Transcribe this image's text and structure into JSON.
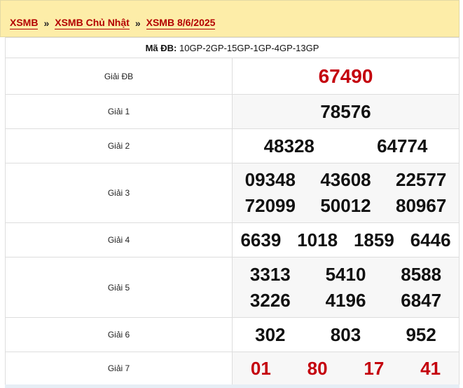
{
  "breadcrumb": {
    "items": [
      "XSMB",
      "XSMB Chủ Nhật",
      "XSMB 8/6/2025"
    ],
    "separator": "»"
  },
  "ma_db": {
    "label": "Mã ĐB:",
    "value": "10GP-2GP-15GP-1GP-4GP-13GP"
  },
  "prizes": [
    {
      "label": "Giải ĐB",
      "numbers": [
        "67490"
      ]
    },
    {
      "label": "Giải 1",
      "numbers": [
        "78576"
      ]
    },
    {
      "label": "Giải 2",
      "numbers": [
        "48328",
        "64774"
      ]
    },
    {
      "label": "Giải 3",
      "numbers": [
        "09348",
        "43608",
        "22577",
        "72099",
        "50012",
        "80967"
      ]
    },
    {
      "label": "Giải 4",
      "numbers": [
        "6639",
        "1018",
        "1859",
        "6446"
      ]
    },
    {
      "label": "Giải 5",
      "numbers": [
        "3313",
        "5410",
        "8588",
        "3226",
        "4196",
        "6847"
      ]
    },
    {
      "label": "Giải 6",
      "numbers": [
        "302",
        "803",
        "952"
      ]
    },
    {
      "label": "Giải 7",
      "numbers": [
        "01",
        "80",
        "17",
        "41"
      ]
    }
  ],
  "colors": {
    "accent_red": "#c4000c",
    "breadcrumb_bg": "#fdeda8"
  }
}
